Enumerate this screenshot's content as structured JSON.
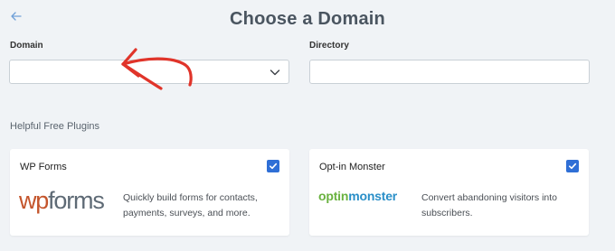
{
  "header": {
    "title": "Choose a Domain",
    "back_icon": "arrow-left-icon"
  },
  "form": {
    "domain_label": "Domain",
    "domain_value": "",
    "directory_label": "Directory",
    "directory_value": ""
  },
  "plugins_section": {
    "label": "Helpful Free Plugins",
    "items": [
      {
        "name": "WP Forms",
        "checked": true,
        "logo_parts": [
          "wp",
          "forms"
        ],
        "description": "Quickly build forms for contacts, payments, surveys, and more."
      },
      {
        "name": "Opt-in Monster",
        "checked": true,
        "logo_parts": [
          "optin",
          "monster"
        ],
        "description": "Convert abandoning visitors into subscribers."
      }
    ]
  },
  "colors": {
    "accent": "#2f6fd6",
    "annotation": "#e0342a",
    "background": "#f0f3f6"
  }
}
